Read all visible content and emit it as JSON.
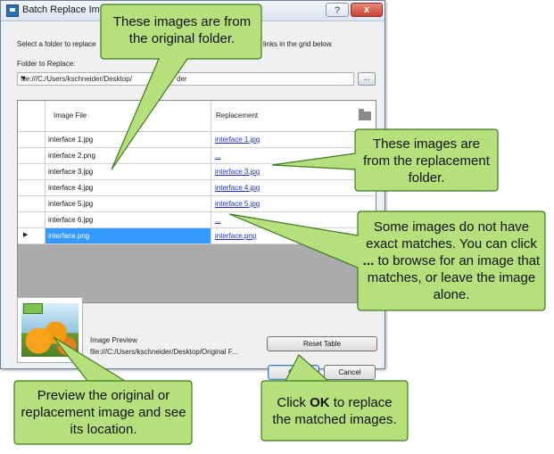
{
  "window": {
    "title": "Batch Replace Images",
    "help_label": "?",
    "close_label": "x"
  },
  "instructions": {
    "left": "Select a folder to replace",
    "right": "links in the grid below."
  },
  "folder": {
    "label": "Folder to Replace:",
    "value": "file:///C:/Users/kschneider/Desktop/",
    "value_tail": "der",
    "browse_label": "..."
  },
  "grid": {
    "col_file": "Image File",
    "col_replacement": "Replacement",
    "rows": [
      {
        "file": "interface 1.jpg",
        "replacement": "interface 1.jpg"
      },
      {
        "file": "interface 2.png",
        "replacement": "..."
      },
      {
        "file": "interface 3.jpg",
        "replacement": "interface 3.jpg"
      },
      {
        "file": "interface 4.jpg",
        "replacement": "interface 4.jpg"
      },
      {
        "file": "interface 5.jpg",
        "replacement": "interface 5.jpg"
      },
      {
        "file": "interface 6.jpg",
        "replacement": "..."
      },
      {
        "file": "interface.png",
        "replacement": "interface.png"
      }
    ]
  },
  "preview": {
    "label": "Image Preview",
    "path": "file:///C:/Users/kschneider/Desktop/Original F..."
  },
  "buttons": {
    "reset": "Reset Table",
    "ok": "OK",
    "cancel": "Cancel"
  },
  "callouts": {
    "original": "These images are from the original folder.",
    "replacement": "These images are from the replacement folder.",
    "matches": "Some images do not have exact matches. You can click ... to browse for an image that matches, or leave the image alone.",
    "matches_pre": "Some images do not have exact matches. You can click ",
    "matches_bold": "...",
    "matches_post": " to browse for an image that matches, or leave the image alone.",
    "preview": "Preview the original or replacement image and see its location.",
    "ok_pre": "Click ",
    "ok_bold": "OK",
    "ok_post": " to replace the matched images."
  },
  "colors": {
    "callout_fill": "#b6e07c",
    "callout_stroke": "#3f7a1f",
    "selection": "#3399ff",
    "link": "#1a2ed0"
  }
}
